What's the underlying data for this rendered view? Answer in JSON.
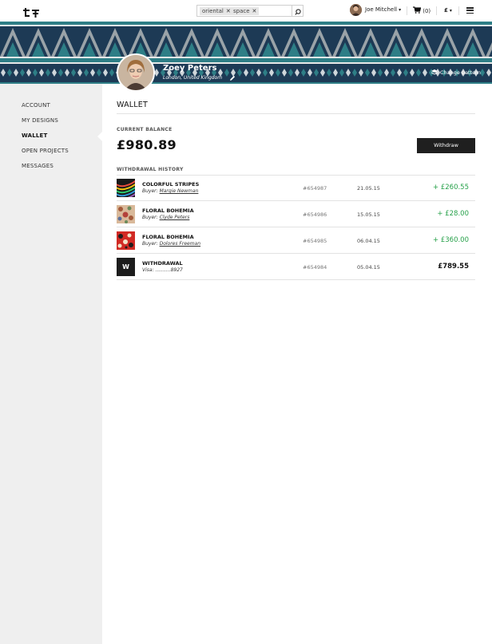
{
  "header": {
    "search_tags": [
      "oriental",
      "space"
    ],
    "search_value": "",
    "user_name": "Joe Mitchell",
    "cart_label": "(0)",
    "currency": "£"
  },
  "banner": {
    "profile_name": "Zoey Peters",
    "profile_location": "London, United Kingdom",
    "change_pattern_label": "Change pattern"
  },
  "sidebar": {
    "items": [
      {
        "label": "ACCOUNT"
      },
      {
        "label": "MY DESIGNS"
      },
      {
        "label": "WALLET"
      },
      {
        "label": "OPEN PROJECTS"
      },
      {
        "label": "MESSAGES"
      }
    ]
  },
  "main": {
    "title": "WALLET",
    "balance_label": "CURRENT BALANCE",
    "balance": "£980.89",
    "withdraw_label": "Withdraw",
    "history_label": "WITHDRAWAL HISTORY",
    "rows": [
      {
        "title": "COLORFUL STRIPES",
        "sub_prefix": "Buyer:",
        "sub_value": "Margie Newman",
        "id": "#654987",
        "date": "21.05.15",
        "amount": "+ £260.55"
      },
      {
        "title": "FLORAL BOHEMIA",
        "sub_prefix": "Buyer:",
        "sub_value": "Clyde Peters",
        "id": "#654986",
        "date": "15.05.15",
        "amount": "+ £28.00"
      },
      {
        "title": "FLORAL BOHEMIA",
        "sub_prefix": "Buyer:",
        "sub_value": "Dolores Freeman",
        "id": "#654985",
        "date": "06.04.15",
        "amount": "+ £360.00"
      },
      {
        "title": "WITHDRAWAL",
        "sub_prefix": "Visa:",
        "sub_value": "..........8927",
        "id": "#654984",
        "date": "05.04.15",
        "amount": "£789.55",
        "thumb_letter": "W"
      }
    ]
  },
  "colors": {
    "banner_bg": "#1d3a55",
    "positive": "#27a14a",
    "button": "#1f1f1f",
    "sidebar_bg": "#efefef"
  }
}
